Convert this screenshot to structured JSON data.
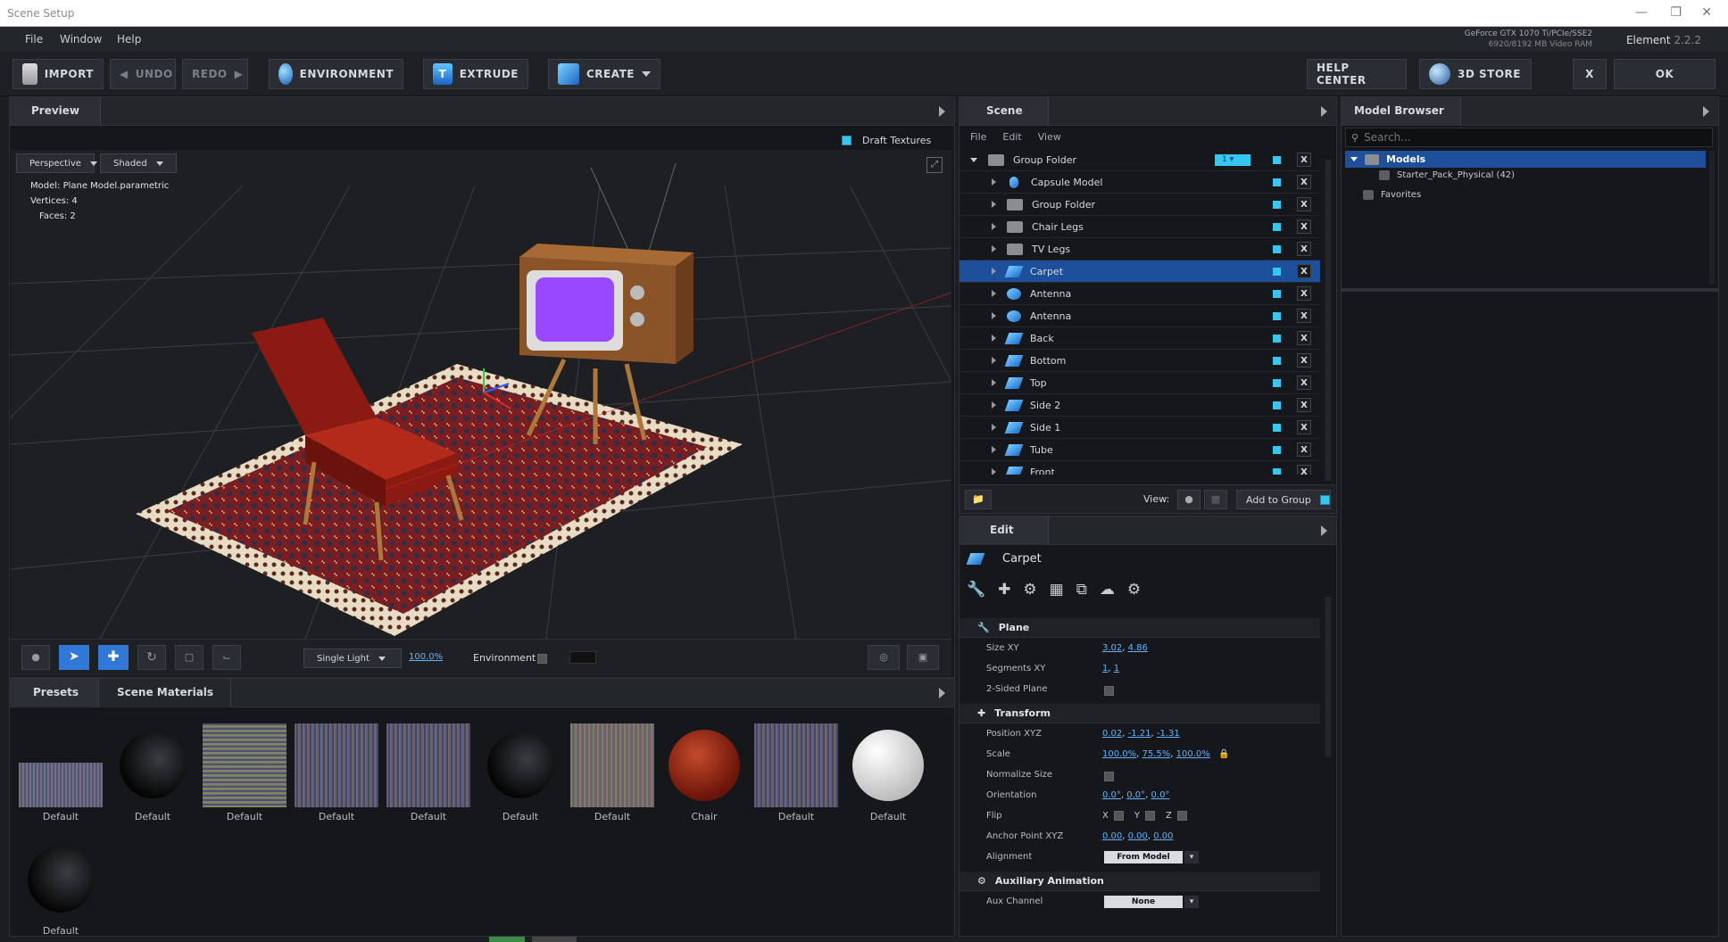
{
  "window": {
    "title": "Scene Setup"
  },
  "menu": [
    "File",
    "Window",
    "Help"
  ],
  "gpu": {
    "line1": "GeForce GTX 1070 Ti/PCIe/SSE2",
    "line2": "6920/8192 MB Video RAM"
  },
  "element": {
    "name": "Element",
    "version": "2.2.2"
  },
  "toolbar": {
    "import": "IMPORT",
    "undo": "UNDO",
    "redo": "REDO",
    "environment": "ENVIRONMENT",
    "extrude": "EXTRUDE",
    "create": "CREATE",
    "help": "HELP CENTER",
    "store": "3D STORE",
    "close": "X",
    "ok": "OK"
  },
  "preview": {
    "tab": "Preview",
    "draft": "Draft Textures",
    "camera": "Perspective",
    "shading": "Shaded",
    "model": "Model:  Plane Model.parametric",
    "vertices": "Vertices:  4",
    "faces": "Faces:  2",
    "light": "Single Light",
    "light_pct": "100.0%",
    "env_label": "Environment"
  },
  "scene": {
    "tab": "Scene",
    "menus": [
      "File",
      "Edit",
      "View"
    ],
    "root": "Group Folder",
    "root_count": "1",
    "items": [
      {
        "label": "Capsule Model",
        "icon": "capsule-icon"
      },
      {
        "label": "Group Folder",
        "icon": "folder-icon"
      },
      {
        "label": "Chair Legs",
        "icon": "folder-icon"
      },
      {
        "label": "TV Legs",
        "icon": "folder-icon"
      },
      {
        "label": "Carpet",
        "icon": "plane-icon",
        "selected": true
      },
      {
        "label": "Antenna",
        "icon": "model-icon"
      },
      {
        "label": "Antenna",
        "icon": "model-icon"
      },
      {
        "label": "Back",
        "icon": "plane-icon"
      },
      {
        "label": "Bottom",
        "icon": "plane-icon"
      },
      {
        "label": "Top",
        "icon": "plane-icon"
      },
      {
        "label": "Side 2",
        "icon": "plane-icon"
      },
      {
        "label": "Side 1",
        "icon": "plane-icon"
      },
      {
        "label": "Tube",
        "icon": "plane-icon"
      },
      {
        "label": "Front",
        "icon": "plane-icon"
      }
    ],
    "view_label": "View:",
    "add_group": "Add to Group"
  },
  "edit": {
    "tab": "Edit",
    "object": "Carpet",
    "plane": {
      "title": "Plane",
      "size_label": "Size XY",
      "size_x": "3.02",
      "size_y": "4.86",
      "seg_label": "Segments XY",
      "seg_x": "1",
      "seg_y": "1",
      "twosided": "2-Sided Plane"
    },
    "transform": {
      "title": "Transform",
      "pos_label": "Position XYZ",
      "pos": [
        "0.02",
        "-1.21",
        "-1.31"
      ],
      "scale_label": "Scale",
      "scale": [
        "100.0%",
        "75.5%",
        "100.0%"
      ],
      "normalize": "Normalize Size",
      "orient_label": "Orientation",
      "orient": [
        "0.0°",
        "0.0°",
        "0.0°"
      ],
      "flip_label": "Flip",
      "flip_axes": [
        "X",
        "Y",
        "Z"
      ],
      "anchor_label": "Anchor Point XYZ",
      "anchor": [
        "0.00",
        "0.00",
        "0.00"
      ],
      "align_label": "Alignment",
      "align": "From Model"
    },
    "aux": {
      "title": "Auxiliary Animation",
      "channel_label": "Aux Channel",
      "channel": "None"
    }
  },
  "browser": {
    "tab": "Model Browser",
    "search_placeholder": "Search...",
    "models": "Models",
    "pack": "Starter_Pack_Physical (42)",
    "favorites": "Favorites"
  },
  "materials": {
    "tabs": [
      "Presets",
      "Scene Materials"
    ],
    "items": [
      {
        "label": "Default",
        "kind": "noise-small"
      },
      {
        "label": "Default",
        "kind": "black-sphere"
      },
      {
        "label": "Default",
        "kind": "noise-green"
      },
      {
        "label": "Default",
        "kind": "noise"
      },
      {
        "label": "Default",
        "kind": "noise"
      },
      {
        "label": "Default",
        "kind": "black-sphere"
      },
      {
        "label": "Default",
        "kind": "noise-warm"
      },
      {
        "label": "Chair",
        "kind": "red-sphere"
      },
      {
        "label": "Default",
        "kind": "noise"
      },
      {
        "label": "Default",
        "kind": "white-sphere"
      },
      {
        "label": "Default",
        "kind": "black-sphere"
      }
    ]
  }
}
